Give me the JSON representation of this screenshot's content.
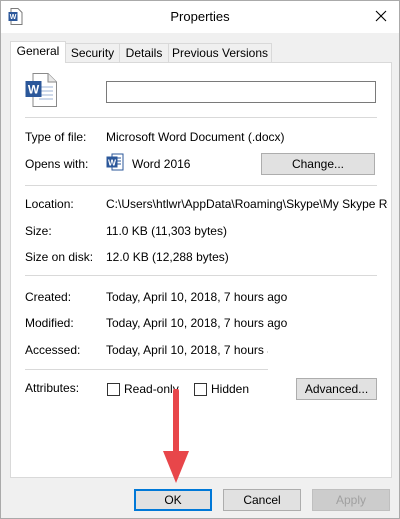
{
  "window": {
    "title": "Properties",
    "icon": "word-document-icon",
    "close_icon": "close-icon"
  },
  "tabs": [
    {
      "label": "General",
      "active": true
    },
    {
      "label": "Security",
      "active": false
    },
    {
      "label": "Details",
      "active": false
    },
    {
      "label": "Previous Versions",
      "active": false
    }
  ],
  "general": {
    "file_icon": "word-document-icon",
    "filename_value": "",
    "type_label": "Type of file:",
    "type_value": "Microsoft Word Document (.docx)",
    "opens_label": "Opens with:",
    "opens_value": "Word 2016",
    "opens_icon": "word-app-icon",
    "change_button": "Change...",
    "location_label": "Location:",
    "location_value": "C:\\Users\\htlwr\\AppData\\Roaming\\Skype\\My Skype Re",
    "size_label": "Size:",
    "size_value": "11.0 KB (11,303 bytes)",
    "size_disk_label": "Size on disk:",
    "size_disk_value": "12.0 KB (12,288 bytes)",
    "created_label": "Created:",
    "created_value": "Today, April 10, 2018, 7 hours ago",
    "modified_label": "Modified:",
    "modified_value": "Today, April 10, 2018, 7 hours ago",
    "accessed_label": "Accessed:",
    "accessed_value": "Today, April 10, 2018, 7 hours ago",
    "attributes_label": "Attributes:",
    "readonly_label": "Read-only",
    "readonly_checked": false,
    "hidden_label": "Hidden",
    "hidden_checked": false,
    "advanced_button": "Advanced..."
  },
  "footer": {
    "ok_button": "OK",
    "cancel_button": "Cancel",
    "apply_button": "Apply"
  },
  "colors": {
    "accent": "#0078d7",
    "annotation_arrow": "#e8464a"
  }
}
